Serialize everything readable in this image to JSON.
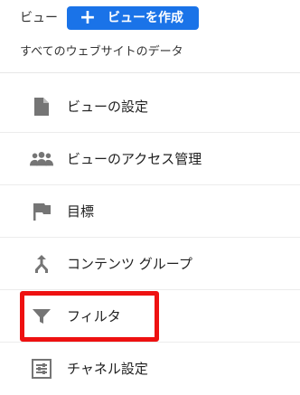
{
  "header": {
    "view_label": "ビュー",
    "create_button_label": "ビューを作成",
    "accent_color": "#1a73e8"
  },
  "account": {
    "path_label": "すべてのウェブサイトのデータ"
  },
  "menu": {
    "items": [
      {
        "label": "ビューの設定",
        "icon": "document-icon"
      },
      {
        "label": "ビューのアクセス管理",
        "icon": "people-icon"
      },
      {
        "label": "目標",
        "icon": "flag-icon"
      },
      {
        "label": "コンテンツ グループ",
        "icon": "merge-icon"
      },
      {
        "label": "フィルタ",
        "icon": "filter-icon"
      },
      {
        "label": "チャネル設定",
        "icon": "channel-settings-icon"
      }
    ]
  },
  "annotation": {
    "highlight_color": "#ee1111",
    "highlighted_item": "フィルタ"
  }
}
